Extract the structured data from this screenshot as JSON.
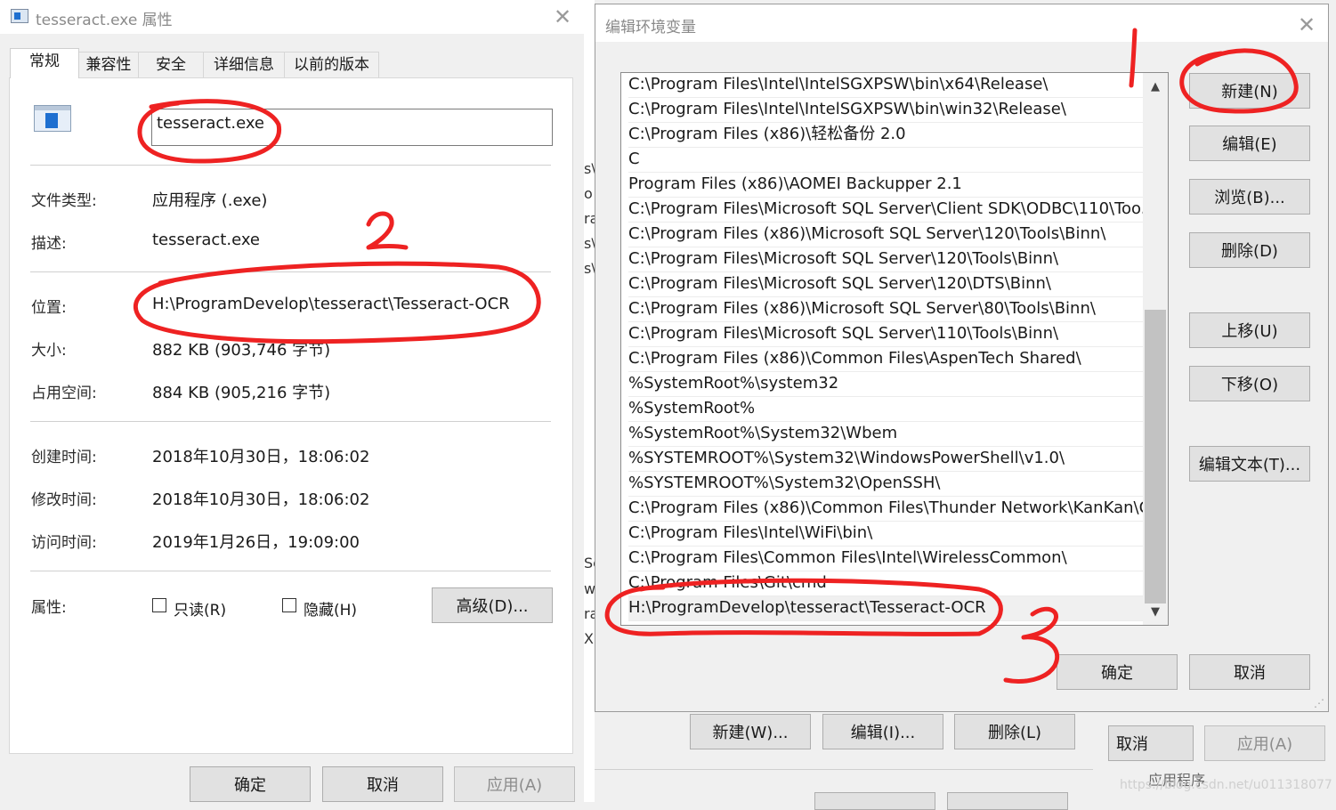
{
  "props_dialog": {
    "title": "tesseract.exe 属性",
    "tabs": [
      "常规",
      "兼容性",
      "安全",
      "详细信息",
      "以前的版本"
    ],
    "file_name": "tesseract.exe",
    "fields": [
      {
        "label": "文件类型:",
        "value": "应用程序 (.exe)"
      },
      {
        "label": "描述:",
        "value": "tesseract.exe"
      },
      {
        "label": "位置:",
        "value": "H:\\ProgramDevelop\\tesseract\\Tesseract-OCR"
      },
      {
        "label": "大小:",
        "value": "882 KB (903,746 字节)"
      },
      {
        "label": "占用空间:",
        "value": "884 KB (905,216 字节)"
      },
      {
        "label": "创建时间:",
        "value": "2018年10月30日，18:06:02"
      },
      {
        "label": "修改时间:",
        "value": "2018年10月30日，18:06:02"
      },
      {
        "label": "访问时间:",
        "value": "2019年1月26日，19:09:00"
      }
    ],
    "attributes_label": "属性:",
    "readonly_label": "只读(R)",
    "hidden_label": "隐藏(H)",
    "advanced_button": "高级(D)...",
    "ok_button": "确定",
    "cancel_button": "取消",
    "apply_button": "应用(A)"
  },
  "env_dialog": {
    "title": "编辑环境变量",
    "paths": [
      "C:\\Program Files\\Intel\\IntelSGXPSW\\bin\\x64\\Release\\",
      "C:\\Program Files\\Intel\\IntelSGXPSW\\bin\\win32\\Release\\",
      "C:\\Program Files (x86)\\轻松备份 2.0",
      "C",
      "Program Files (x86)\\AOMEI Backupper 2.1",
      "C:\\Program Files\\Microsoft SQL Server\\Client SDK\\ODBC\\110\\Too...",
      "C:\\Program Files (x86)\\Microsoft SQL Server\\120\\Tools\\Binn\\",
      "C:\\Program Files\\Microsoft SQL Server\\120\\Tools\\Binn\\",
      "C:\\Program Files\\Microsoft SQL Server\\120\\DTS\\Binn\\",
      "C:\\Program Files (x86)\\Microsoft SQL Server\\80\\Tools\\Binn\\",
      "C:\\Program Files\\Microsoft SQL Server\\110\\Tools\\Binn\\",
      "C:\\Program Files (x86)\\Common Files\\AspenTech Shared\\",
      "%SystemRoot%\\system32",
      "%SystemRoot%",
      "%SystemRoot%\\System32\\Wbem",
      "%SYSTEMROOT%\\System32\\WindowsPowerShell\\v1.0\\",
      "%SYSTEMROOT%\\System32\\OpenSSH\\",
      "C:\\Program Files (x86)\\Common Files\\Thunder Network\\KanKan\\C...",
      "C:\\Program Files\\Intel\\WiFi\\bin\\",
      "C:\\Program Files\\Common Files\\Intel\\WirelessCommon\\",
      "C:\\Program Files\\Git\\cmd",
      "H:\\ProgramDevelop\\tesseract\\Tesseract-OCR"
    ],
    "buttons": {
      "new": "新建(N)",
      "edit": "编辑(E)",
      "browse": "浏览(B)...",
      "delete": "删除(D)",
      "move_up": "上移(U)",
      "move_down": "下移(O)",
      "edit_text": "编辑文本(T)...",
      "ok": "确定",
      "cancel": "取消"
    }
  },
  "back_dialog": {
    "buttons": {
      "new": "新建(W)...",
      "edit": "编辑(I)...",
      "delete": "删除(L)",
      "cancel": "取消",
      "apply": "应用(A)"
    },
    "text_fragments": [
      "应用程序"
    ]
  },
  "middle_fragments": [
    "s\\",
    "o",
    "ra",
    "s\\",
    "s\\",
    "Se",
    "ws",
    "ra",
    "X"
  ],
  "annotations": {
    "marks": [
      "1",
      "2",
      "3"
    ],
    "color": "#ee2222"
  },
  "watermark": "https://blog.csdn.net/u011318077"
}
